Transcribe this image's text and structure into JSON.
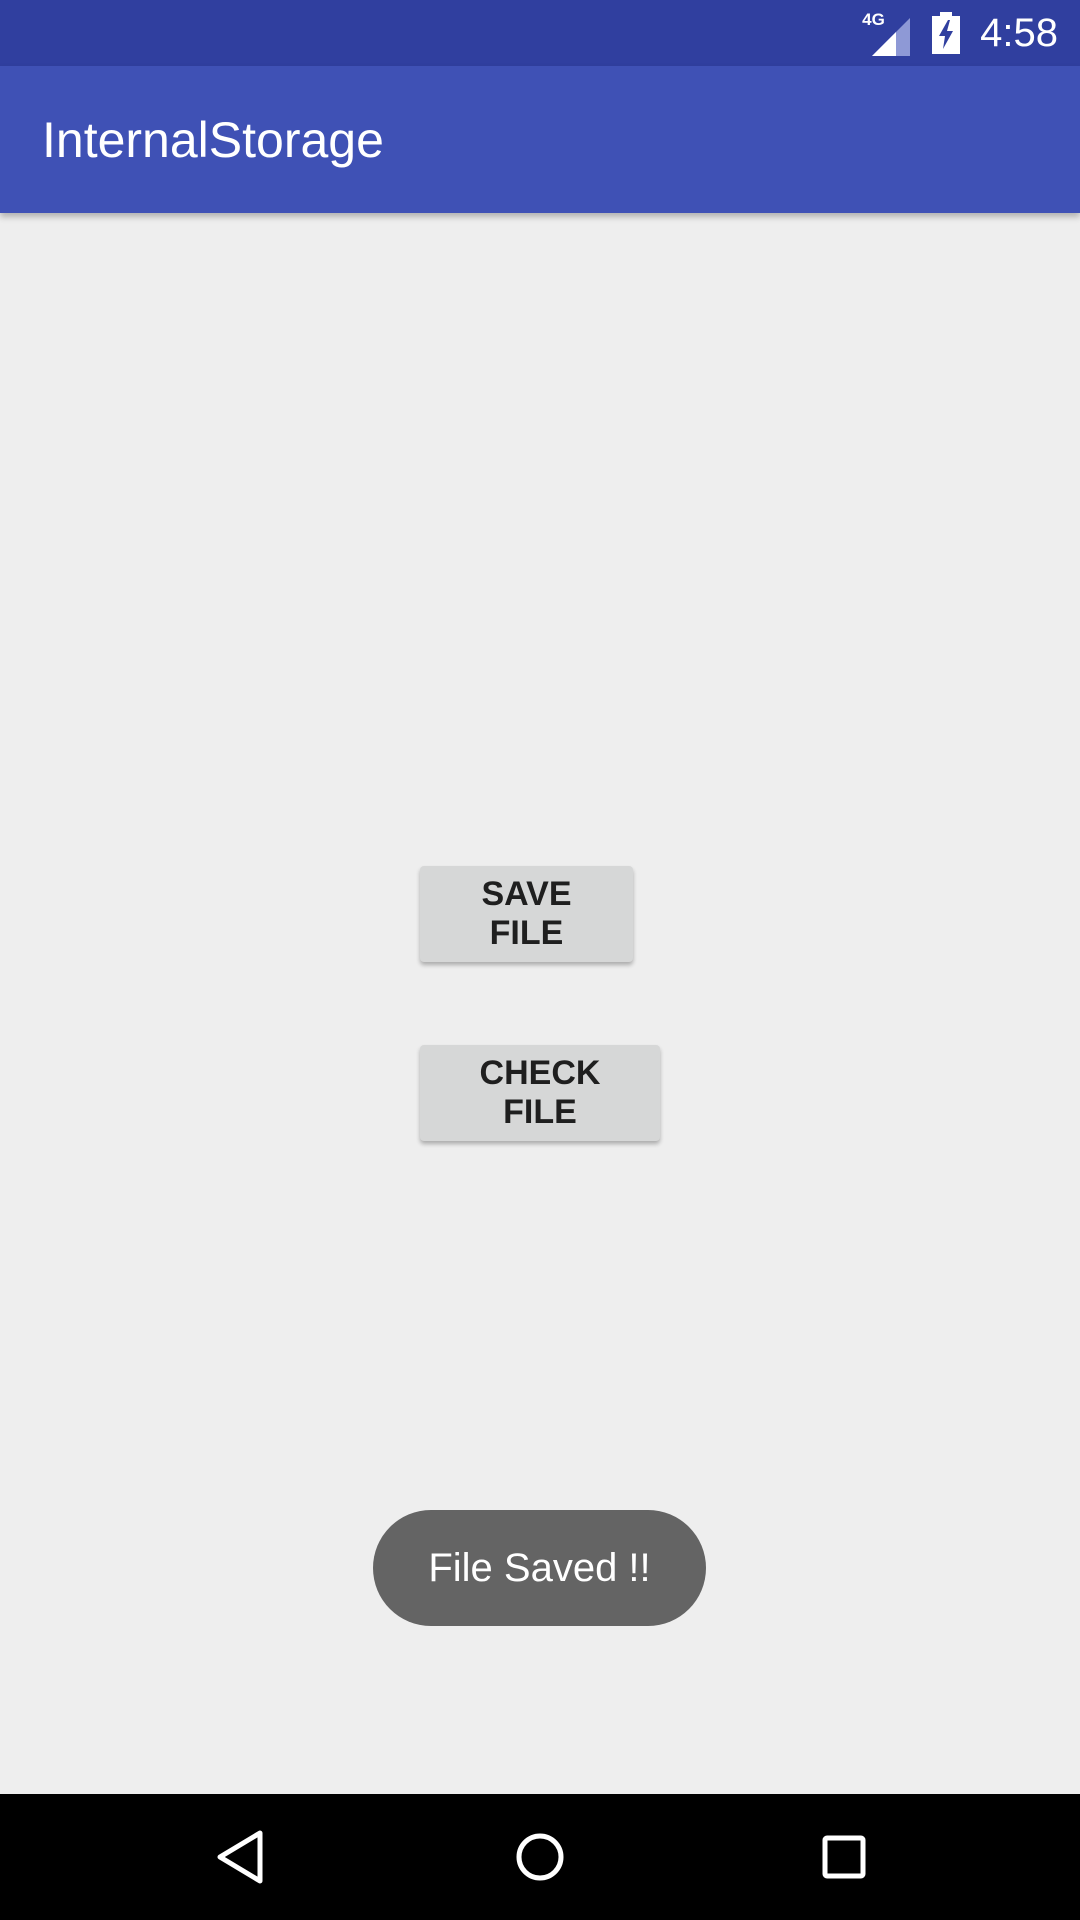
{
  "status_bar": {
    "network": "4G",
    "time": "4:58",
    "icons": [
      "signal-icon",
      "battery-charging-icon"
    ]
  },
  "app_bar": {
    "title": "InternalStorage"
  },
  "buttons": {
    "save_label": "SAVE FILE",
    "check_label": "CHECK FILE"
  },
  "toast": {
    "message": "File Saved !!"
  },
  "nav_bar": {
    "icons": [
      "back-icon",
      "home-icon",
      "recents-icon"
    ]
  },
  "colors": {
    "status_bar": "#303f9f",
    "app_bar": "#3f51b5",
    "background": "#eeeeee",
    "button": "#d6d7d7",
    "toast": "#646464",
    "nav_bar": "#000000"
  }
}
